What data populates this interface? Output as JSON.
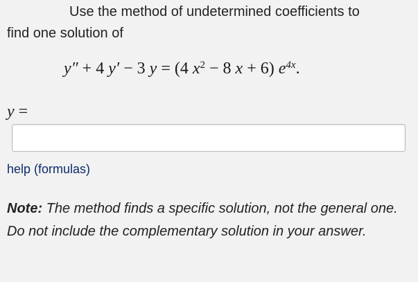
{
  "problem": {
    "line1": "Use the method of undetermined coefficients to",
    "line2": "find one solution of"
  },
  "equation": {
    "lhs_y2": "y″",
    "lhs_plus1": " + 4 ",
    "lhs_y1": "y′",
    "lhs_minus": " − 3 ",
    "lhs_y0": "y",
    "equals": " = (4 ",
    "x1": "x",
    "x1_exp": "2",
    "middle": " − 8 ",
    "x2": "x",
    "tail": " + 6) ",
    "e": "e",
    "e_exp": "4x",
    "period": "."
  },
  "answer": {
    "label_var": "y",
    "label_eq": " =",
    "input_value": "",
    "input_placeholder": ""
  },
  "help": {
    "label": "help (formulas)"
  },
  "note": {
    "label": "Note:",
    "text": " The method finds a specific solution, not the general one. Do not include the complementary solution in your answer."
  }
}
